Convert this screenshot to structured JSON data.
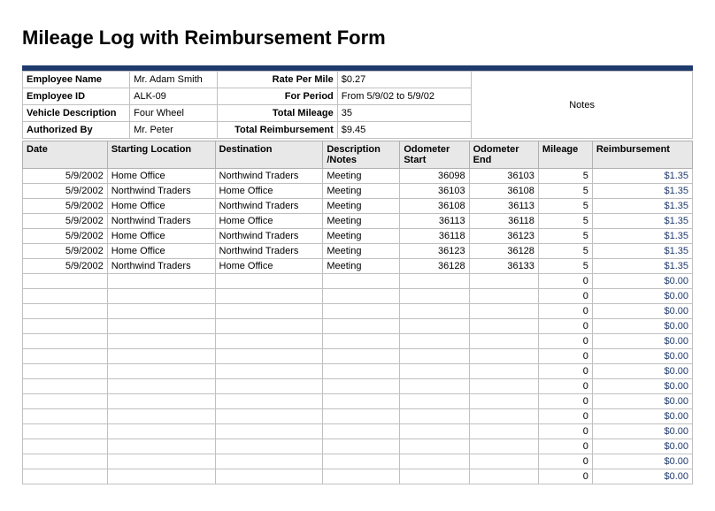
{
  "title": "Mileage Log with Reimbursement Form",
  "meta": {
    "labels": {
      "employee_name": "Employee Name",
      "employee_id": "Employee ID",
      "vehicle_description": "Vehicle Description",
      "authorized_by": "Authorized By",
      "rate_per_mile": "Rate Per Mile",
      "for_period": "For Period",
      "total_mileage": "Total Mileage",
      "total_reimbursement": "Total Reimbursement",
      "notes": "Notes"
    },
    "values": {
      "employee_name": "Mr. Adam Smith",
      "employee_id": "ALK-09",
      "vehicle_description": "Four Wheel",
      "authorized_by": "Mr. Peter",
      "rate_per_mile": "$0.27",
      "for_period": "From 5/9/02 to 5/9/02",
      "total_mileage": "35",
      "total_reimbursement": "$9.45"
    }
  },
  "columns": {
    "date": "Date",
    "starting_location": "Starting Location",
    "destination": "Destination",
    "description": "Description /Notes",
    "odometer_start": "Odometer Start",
    "odometer_end": "Odometer End",
    "mileage": "Mileage",
    "reimbursement": "Reimbursement"
  },
  "rows": [
    {
      "date": "5/9/2002",
      "start": "Home Office",
      "dest": "Northwind Traders",
      "desc": "Meeting",
      "odstart": "36098",
      "odend": "36103",
      "mileage": "5",
      "reimb": "$1.35"
    },
    {
      "date": "5/9/2002",
      "start": "Northwind Traders",
      "dest": "Home Office",
      "desc": "Meeting",
      "odstart": "36103",
      "odend": "36108",
      "mileage": "5",
      "reimb": "$1.35"
    },
    {
      "date": "5/9/2002",
      "start": "Home Office",
      "dest": "Northwind Traders",
      "desc": "Meeting",
      "odstart": "36108",
      "odend": "36113",
      "mileage": "5",
      "reimb": "$1.35"
    },
    {
      "date": "5/9/2002",
      "start": "Northwind Traders",
      "dest": "Home Office",
      "desc": "Meeting",
      "odstart": "36113",
      "odend": "36118",
      "mileage": "5",
      "reimb": "$1.35"
    },
    {
      "date": "5/9/2002",
      "start": "Home Office",
      "dest": "Northwind Traders",
      "desc": "Meeting",
      "odstart": "36118",
      "odend": "36123",
      "mileage": "5",
      "reimb": "$1.35"
    },
    {
      "date": "5/9/2002",
      "start": "Home Office",
      "dest": "Northwind Traders",
      "desc": "Meeting",
      "odstart": "36123",
      "odend": "36128",
      "mileage": "5",
      "reimb": "$1.35"
    },
    {
      "date": "5/9/2002",
      "start": "Northwind Traders",
      "dest": "Home Office",
      "desc": "Meeting",
      "odstart": "36128",
      "odend": "36133",
      "mileage": "5",
      "reimb": "$1.35"
    },
    {
      "date": "",
      "start": "",
      "dest": "",
      "desc": "",
      "odstart": "",
      "odend": "",
      "mileage": "0",
      "reimb": "$0.00"
    },
    {
      "date": "",
      "start": "",
      "dest": "",
      "desc": "",
      "odstart": "",
      "odend": "",
      "mileage": "0",
      "reimb": "$0.00"
    },
    {
      "date": "",
      "start": "",
      "dest": "",
      "desc": "",
      "odstart": "",
      "odend": "",
      "mileage": "0",
      "reimb": "$0.00"
    },
    {
      "date": "",
      "start": "",
      "dest": "",
      "desc": "",
      "odstart": "",
      "odend": "",
      "mileage": "0",
      "reimb": "$0.00"
    },
    {
      "date": "",
      "start": "",
      "dest": "",
      "desc": "",
      "odstart": "",
      "odend": "",
      "mileage": "0",
      "reimb": "$0.00"
    },
    {
      "date": "",
      "start": "",
      "dest": "",
      "desc": "",
      "odstart": "",
      "odend": "",
      "mileage": "0",
      "reimb": "$0.00"
    },
    {
      "date": "",
      "start": "",
      "dest": "",
      "desc": "",
      "odstart": "",
      "odend": "",
      "mileage": "0",
      "reimb": "$0.00"
    },
    {
      "date": "",
      "start": "",
      "dest": "",
      "desc": "",
      "odstart": "",
      "odend": "",
      "mileage": "0",
      "reimb": "$0.00"
    },
    {
      "date": "",
      "start": "",
      "dest": "",
      "desc": "",
      "odstart": "",
      "odend": "",
      "mileage": "0",
      "reimb": "$0.00"
    },
    {
      "date": "",
      "start": "",
      "dest": "",
      "desc": "",
      "odstart": "",
      "odend": "",
      "mileage": "0",
      "reimb": "$0.00"
    },
    {
      "date": "",
      "start": "",
      "dest": "",
      "desc": "",
      "odstart": "",
      "odend": "",
      "mileage": "0",
      "reimb": "$0.00"
    },
    {
      "date": "",
      "start": "",
      "dest": "",
      "desc": "",
      "odstart": "",
      "odend": "",
      "mileage": "0",
      "reimb": "$0.00"
    },
    {
      "date": "",
      "start": "",
      "dest": "",
      "desc": "",
      "odstart": "",
      "odend": "",
      "mileage": "0",
      "reimb": "$0.00"
    },
    {
      "date": "",
      "start": "",
      "dest": "",
      "desc": "",
      "odstart": "",
      "odend": "",
      "mileage": "0",
      "reimb": "$0.00"
    }
  ]
}
